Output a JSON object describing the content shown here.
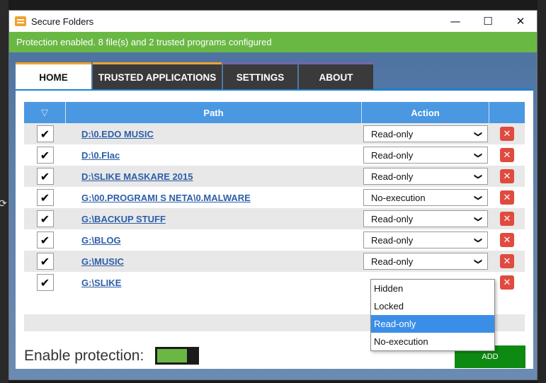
{
  "window": {
    "title": "Secure Folders",
    "controls": {
      "minimize": "—",
      "maximize": "☐",
      "close": "✕"
    }
  },
  "status": {
    "text": "Protection enabled. 8 file(s) and 2 trusted programs configured",
    "color": "#6ab844"
  },
  "tabs": [
    {
      "label": "HOME",
      "active": true
    },
    {
      "label": "TRUSTED APPLICATIONS",
      "active": false
    },
    {
      "label": "SETTINGS",
      "active": false
    },
    {
      "label": "ABOUT",
      "active": false
    }
  ],
  "table": {
    "headers": {
      "filter_icon": "filter-icon",
      "path": "Path",
      "action": "Action"
    },
    "rows": [
      {
        "checked": true,
        "path": "D:\\0.EDO MUSIC",
        "action": "Read-only"
      },
      {
        "checked": true,
        "path": "D:\\0.Flac",
        "action": "Read-only"
      },
      {
        "checked": true,
        "path": "D:\\SLIKE MASKARE 2015",
        "action": "Read-only"
      },
      {
        "checked": true,
        "path": "G:\\00.PROGRAMI S NETA\\0.MALWARE",
        "action": "No-execution"
      },
      {
        "checked": true,
        "path": "G:\\BACKUP STUFF",
        "action": "Read-only"
      },
      {
        "checked": true,
        "path": "G:\\BLOG",
        "action": "Read-only"
      },
      {
        "checked": true,
        "path": "G:\\MUSIC",
        "action": "Read-only"
      },
      {
        "checked": true,
        "path": "G:\\SLIKE",
        "action": ""
      }
    ]
  },
  "dropdown": {
    "options": [
      "Hidden",
      "Locked",
      "Read-only",
      "No-execution"
    ],
    "selected": "Read-only"
  },
  "footer": {
    "protection_label": "Enable protection:",
    "protection_on": true,
    "add_label": "ADD"
  },
  "colors": {
    "accent": "#f2a12e",
    "header_blue": "#4a97e2",
    "delete_red": "#e04a3f",
    "add_green": "#0e8a12"
  }
}
